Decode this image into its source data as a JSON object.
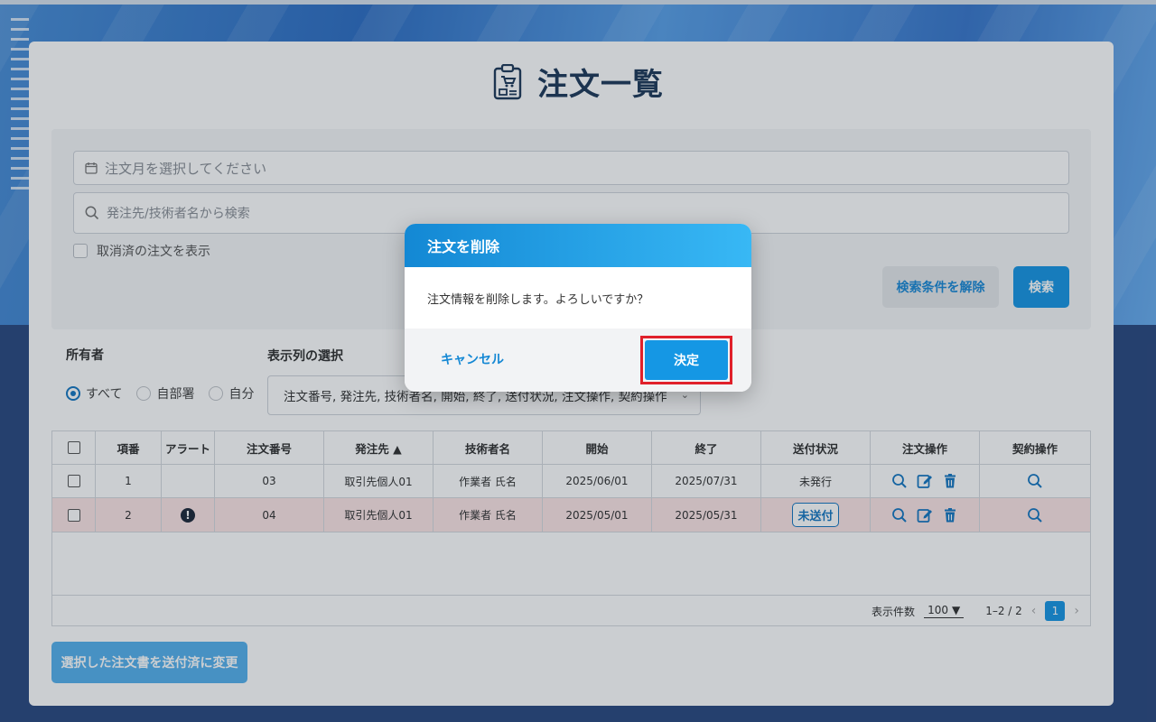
{
  "page": {
    "title": "注文一覧",
    "title_icon": "clipboard-order-icon"
  },
  "filters": {
    "month_placeholder": "注文月を選択してください",
    "search_placeholder": "発注先/技術者名から検索",
    "show_cancelled_label": "取消済の注文を表示",
    "clear_button": "検索条件を解除",
    "search_button": "検索"
  },
  "owner": {
    "label": "所有者",
    "options": [
      "すべて",
      "自部署",
      "自分"
    ],
    "selected": "すべて"
  },
  "columns_select": {
    "label": "表示列の選択",
    "value": "注文番号, 発注先, 技術者名, 開始, 終了, 送付状況, 注文操作, 契約操作"
  },
  "table": {
    "headers": [
      "項番",
      "アラート",
      "注文番号",
      "発注先 ▲",
      "技術者名",
      "開始",
      "終了",
      "送付状況",
      "注文操作",
      "契約操作"
    ],
    "rows": [
      {
        "no": "1",
        "alert": "",
        "order_no": "03",
        "vendor": "取引先個人01",
        "engineer": "作業者 氏名",
        "start": "2025/06/01",
        "end": "2025/07/31",
        "status": "未発行"
      },
      {
        "no": "2",
        "alert": "!",
        "order_no": "04",
        "vendor": "取引先個人01",
        "engineer": "作業者 氏名",
        "start": "2025/05/01",
        "end": "2025/05/31",
        "status": "未送付"
      }
    ],
    "footer": {
      "per_page_label": "表示件数",
      "per_page_value": "100",
      "range": "1–2 / 2",
      "current_page": "1"
    }
  },
  "bulk_button": "選択した注文書を送付済に変更",
  "dialog": {
    "title": "注文を削除",
    "message": "注文情報を削除します。よろしいですか？",
    "cancel": "キャンセル",
    "confirm": "決定"
  },
  "colors": {
    "accent": "#1997e4",
    "highlight_row": "#fde6e6",
    "confirm_frame": "#e0202a"
  }
}
